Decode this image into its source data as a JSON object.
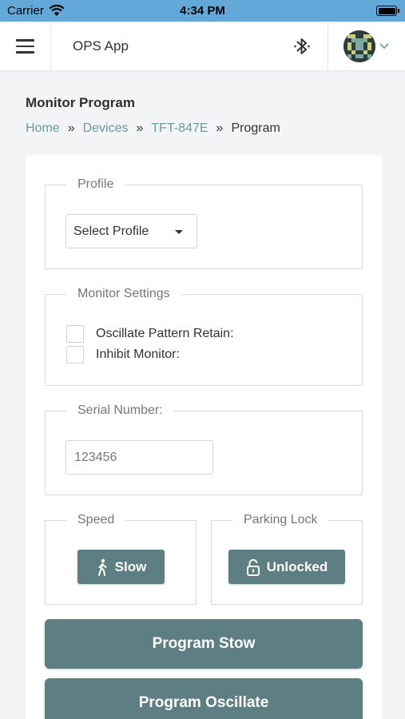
{
  "status_bar": {
    "carrier": "Carrier",
    "time": "4:34 PM"
  },
  "header": {
    "app_title": "OPS App",
    "icons": [
      "menu-icon",
      "bluetooth-icon",
      "avatar",
      "chevron-down-icon"
    ]
  },
  "page": {
    "title": "Monitor Program",
    "breadcrumb": [
      "Home",
      "Devices",
      "TFT-847E",
      "Program"
    ],
    "breadcrumb_separator": "»"
  },
  "profile": {
    "legend": "Profile",
    "select_value": "Select Profile"
  },
  "monitor_settings": {
    "legend": "Monitor Settings",
    "options": [
      {
        "label": "Oscillate Pattern Retain:",
        "checked": false
      },
      {
        "label": "Inhibit Monitor:",
        "checked": false
      }
    ]
  },
  "serial": {
    "legend": "Serial Number:",
    "value": "123456"
  },
  "speed": {
    "legend": "Speed",
    "button_label": "Slow",
    "icon": "walking-person-icon"
  },
  "parking_lock": {
    "legend": "Parking Lock",
    "button_label": "Unlocked",
    "icon": "unlocked-padlock-icon"
  },
  "actions": {
    "program_stow": "Program Stow",
    "program_oscillate": "Program Oscillate"
  },
  "colors": {
    "status_bar": "#62a9da",
    "accent": "#5d7e82",
    "link": "#6d9a9b",
    "background": "#f2f4f6"
  }
}
